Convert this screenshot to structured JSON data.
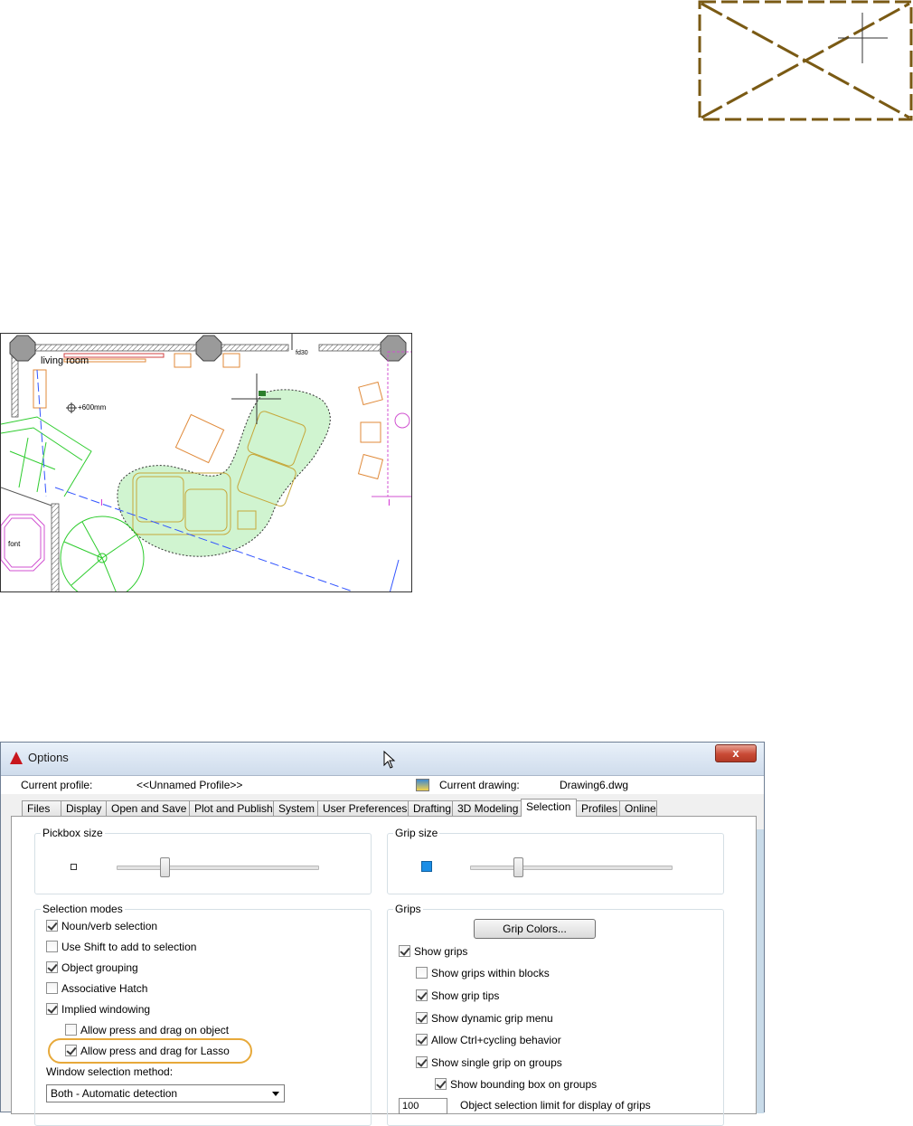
{
  "drawing": {
    "room_label": "living room",
    "elevation_label": "+600mm",
    "tag_label": "fd30",
    "font_label": "font"
  },
  "dialog": {
    "title": "Options",
    "close_glyph": "x",
    "current_profile_label": "Current profile:",
    "current_profile_value": "<<Unnamed Profile>>",
    "current_drawing_label": "Current drawing:",
    "current_drawing_value": "Drawing6.dwg",
    "tabs": [
      "Files",
      "Display",
      "Open and Save",
      "Plot and Publish",
      "System",
      "User Preferences",
      "Drafting",
      "3D Modeling",
      "Selection",
      "Profiles",
      "Online"
    ],
    "active_tab": "Selection",
    "pickbox": {
      "title": "Pickbox size",
      "level": 0.24
    },
    "gripsize": {
      "title": "Grip size",
      "level": 0.24
    },
    "selection_modes": {
      "title": "Selection modes",
      "items": [
        {
          "label": "Noun/verb selection",
          "checked": true
        },
        {
          "label": "Use Shift to add to selection",
          "checked": false
        },
        {
          "label": "Object grouping",
          "checked": true
        },
        {
          "label": "Associative Hatch",
          "checked": false
        },
        {
          "label": "Implied windowing",
          "checked": true
        },
        {
          "label": "Allow press and drag on object",
          "checked": false
        },
        {
          "label": "Allow press and drag for Lasso",
          "checked": true
        }
      ],
      "window_method_label": "Window selection method:",
      "window_method_value": "Both - Automatic detection"
    },
    "grips": {
      "title": "Grips",
      "colors_button": "Grip Colors...",
      "items": [
        {
          "label": "Show grips",
          "checked": true
        },
        {
          "label": "Show grips within blocks",
          "checked": false
        },
        {
          "label": "Show grip tips",
          "checked": true
        },
        {
          "label": "Show dynamic grip menu",
          "checked": true
        },
        {
          "label": "Allow Ctrl+cycling behavior",
          "checked": true
        },
        {
          "label": "Show single grip on groups",
          "checked": true
        },
        {
          "label": "Show bounding box on groups",
          "checked": true
        }
      ],
      "limit_value": "100",
      "limit_label": "Object selection limit for display of grips"
    },
    "colors": {
      "grip_blue": "#1b8ee6",
      "highlight": "#e7a93a",
      "close_red": "#c94a35"
    }
  }
}
